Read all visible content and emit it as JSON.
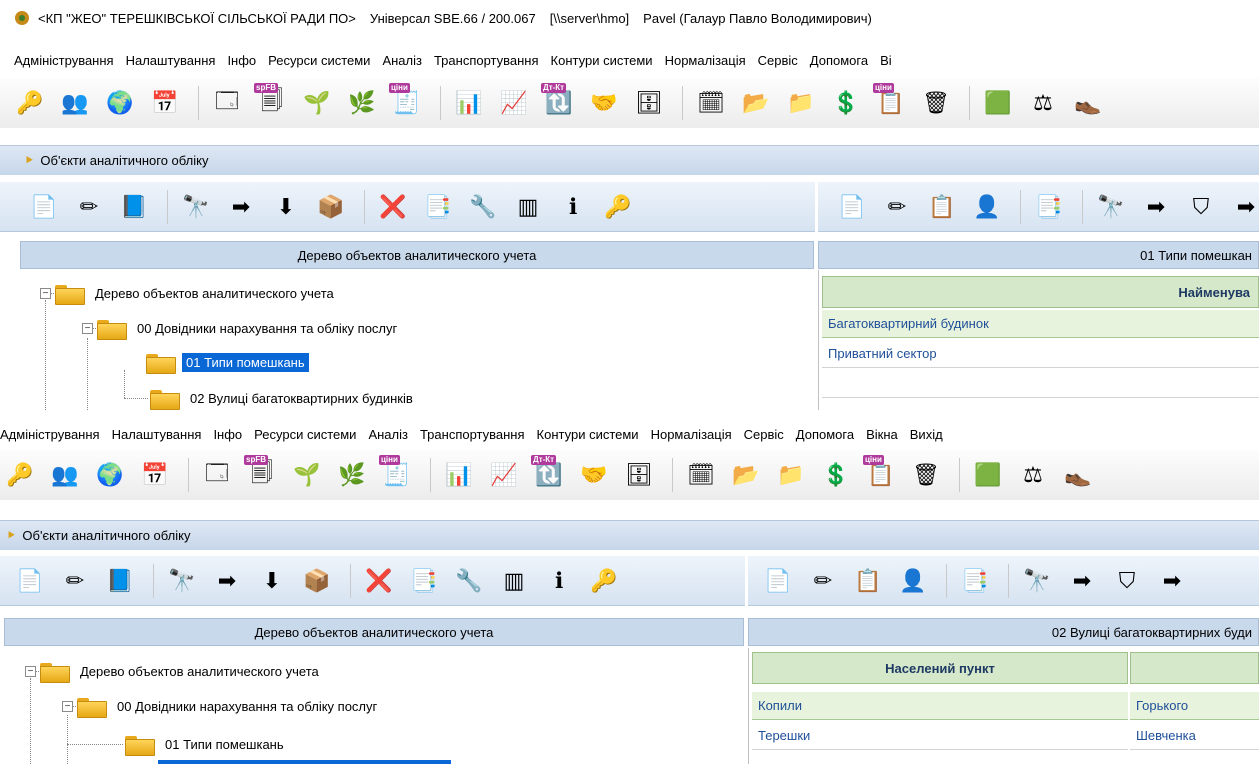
{
  "window": {
    "title_parts": [
      "<КП \"ЖЕО\" ТЕРЕШКІВСЬКОЇ СІЛЬСЬКОЇ РАДИ ПО>",
      "Універсал SBE.66 / 200.067",
      "[\\\\server\\hmo]",
      "Pavel (Галаур Павло Володимирович)"
    ]
  },
  "menu_top": [
    "Адміністрування",
    "Налаштування",
    "Інфо",
    "Ресурси системи",
    "Аналіз",
    "Транспортування",
    "Контури системи",
    "Нормалізація",
    "Сервіс",
    "Допомога",
    "Ві"
  ],
  "menu_bottom": [
    "Адміністрування",
    "Налаштування",
    "Інфо",
    "Ресурси системи",
    "Аналіз",
    "Транспортування",
    "Контури системи",
    "Нормалізація",
    "Сервіс",
    "Допомога",
    "Вікна",
    "Вихід"
  ],
  "main_toolbar_icons": [
    {
      "name": "key-icon",
      "glyph": "🔑"
    },
    {
      "name": "users-icon",
      "glyph": "👥"
    },
    {
      "name": "globe-icon",
      "glyph": "🌍"
    },
    {
      "name": "calendar-icon",
      "glyph": "📅"
    },
    {
      "name": "sep"
    },
    {
      "name": "form-settings-icon",
      "glyph": "🗔"
    },
    {
      "name": "spfb-form-icon",
      "glyph": "🗐",
      "badge": "spFB"
    },
    {
      "name": "tree-person-icon",
      "glyph": "🌱"
    },
    {
      "name": "tree-edit-icon",
      "glyph": "🌿"
    },
    {
      "name": "prices-icon",
      "glyph": "🧾",
      "badge": "ціни"
    },
    {
      "name": "sep"
    },
    {
      "name": "table-clock-icon",
      "glyph": "📊"
    },
    {
      "name": "table-refresh-icon",
      "glyph": "📈"
    },
    {
      "name": "debit-credit-icon",
      "glyph": "🔃",
      "badge": "Дт-Кт"
    },
    {
      "name": "handshake-icon",
      "glyph": "🤝"
    },
    {
      "name": "safe-icon",
      "glyph": "🗄"
    },
    {
      "name": "sep"
    },
    {
      "name": "table-star-icon",
      "glyph": "🗓"
    },
    {
      "name": "folder-tree-icon",
      "glyph": "📂"
    },
    {
      "name": "folder-edit-icon",
      "glyph": "📁"
    },
    {
      "name": "dollar-icon",
      "glyph": "💲"
    },
    {
      "name": "price-list-icon",
      "glyph": "📋",
      "badge": "ціни"
    },
    {
      "name": "trash-bin-icon",
      "glyph": "🗑"
    },
    {
      "name": "sep"
    },
    {
      "name": "cube-icon",
      "glyph": "🟩"
    },
    {
      "name": "scales-icon",
      "glyph": "⚖"
    },
    {
      "name": "shoe-icon",
      "glyph": "👞"
    }
  ],
  "panel_title": "Об'єкти аналітичного обліку",
  "panel_toolbar_icons": [
    {
      "name": "add-doc-icon",
      "glyph": "📄"
    },
    {
      "name": "edit-pencil-icon",
      "glyph": "✏"
    },
    {
      "name": "properties-icon",
      "glyph": "📘"
    },
    {
      "name": "sep"
    },
    {
      "name": "binoculars-icon",
      "glyph": "🔭"
    },
    {
      "name": "find-next-icon",
      "glyph": "➡"
    },
    {
      "name": "download-doc-icon",
      "glyph": "⬇"
    },
    {
      "name": "boxes-icon",
      "glyph": "📦"
    },
    {
      "name": "sep"
    },
    {
      "name": "delete-doc-icon",
      "glyph": "❌"
    },
    {
      "name": "copy-doc-icon",
      "glyph": "📑"
    },
    {
      "name": "tools-check-icon",
      "glyph": "🔧"
    },
    {
      "name": "columns-icon",
      "glyph": "▥"
    },
    {
      "name": "info-icon",
      "glyph": "ℹ"
    },
    {
      "name": "key-icon",
      "glyph": "🔑"
    }
  ],
  "detail_toolbar_icons": [
    {
      "name": "add-doc-icon",
      "glyph": "📄"
    },
    {
      "name": "edit-pencil-icon",
      "glyph": "✏"
    },
    {
      "name": "add-copy-icon",
      "glyph": "📋"
    },
    {
      "name": "user-refresh-icon",
      "glyph": "👤"
    },
    {
      "name": "sep"
    },
    {
      "name": "copy-doc-icon",
      "glyph": "📑"
    },
    {
      "name": "sep"
    },
    {
      "name": "binoculars-icon",
      "glyph": "🔭"
    },
    {
      "name": "find-next-icon",
      "glyph": "➡"
    },
    {
      "name": "filter-icon",
      "glyph": "⛉"
    },
    {
      "name": "find-next-2-icon",
      "glyph": "➡"
    }
  ],
  "tree_header": "Дерево объектов аналитического учета",
  "tree": {
    "root": "Дерево объектов аналитического учета",
    "child": "00 Довідники нарахування та обліку послуг",
    "item1": "01 Типи помешкань",
    "item2": "02 Вулиці багатоквартирних будинків"
  },
  "top_detail": {
    "header": "01 Типи помешкан",
    "column": "Найменува",
    "rows": [
      "Багатоквартирний будинок",
      "Приватний сектор"
    ]
  },
  "bottom_detail": {
    "header": "02 Вулиці багатоквартирних буди",
    "columns": [
      "Населений пункт",
      ""
    ],
    "rows": [
      [
        "Копили",
        "Горького"
      ],
      [
        "Терешки",
        "Шевченка"
      ]
    ]
  }
}
